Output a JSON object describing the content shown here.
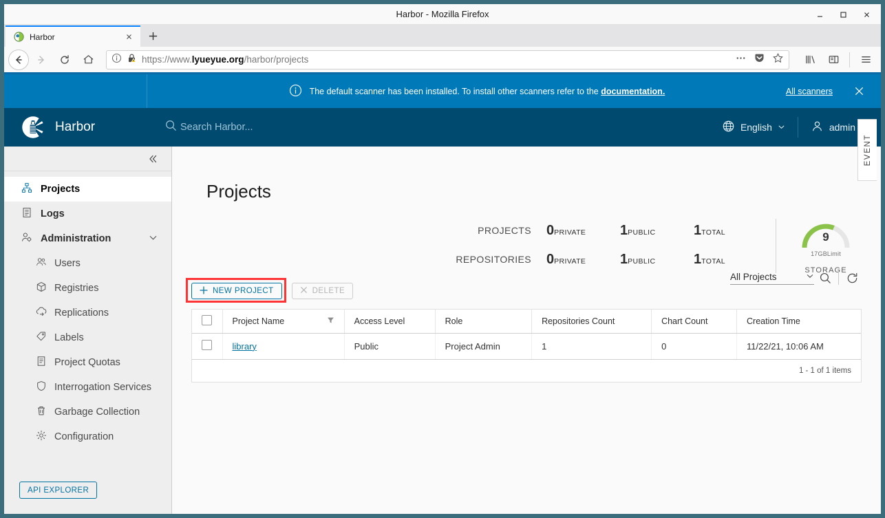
{
  "browser": {
    "window_title": "Harbor - Mozilla Firefox",
    "minimize_label": "Minimize",
    "maximize_label": "Maximize",
    "close_label": "Close",
    "tab": {
      "label": "Harbor",
      "close_label": "Close tab"
    },
    "new_tab_label": "+",
    "nav": {
      "back_label": "Back",
      "forward_label": "Forward",
      "reload_label": "Reload",
      "home_label": "Home"
    },
    "url": {
      "prefix": "https://www.",
      "domain": "lyueyue.org",
      "path": "/harbor/projects",
      "full": "https://www.lyueyue.org/harbor/projects"
    },
    "url_actions": {
      "page_actions": "…",
      "pocket": "Save to Pocket",
      "bookmark": "Bookmark"
    },
    "toolbar": {
      "library": "Library",
      "sidebars": "Sidebars",
      "menu": "Open menu"
    }
  },
  "banner": {
    "icon": "info-circle-icon",
    "message": "The default scanner has been installed. To install other scanners refer to the ",
    "link_text": "documentation.",
    "all_scanners": "All scanners",
    "close": "×",
    "bg_color": "#0079b8"
  },
  "header": {
    "brand": "Harbor",
    "search_placeholder": "Search Harbor...",
    "language": "English",
    "user": "admin",
    "bg_color": "#004a70"
  },
  "event_tab": {
    "label": "EVENT"
  },
  "sidebar": {
    "collapse_label": "«",
    "items": [
      {
        "label": "Projects",
        "icon": "projects-icon",
        "active": true,
        "level": 0
      },
      {
        "label": "Logs",
        "icon": "logs-icon",
        "active": false,
        "level": 0
      },
      {
        "label": "Administration",
        "icon": "administration-icon",
        "active": false,
        "level": 0,
        "expandable": true,
        "chevron": "⌄"
      },
      {
        "label": "Users",
        "icon": "users-icon",
        "active": false,
        "level": 1
      },
      {
        "label": "Registries",
        "icon": "registries-icon",
        "active": false,
        "level": 1
      },
      {
        "label": "Replications",
        "icon": "replications-icon",
        "active": false,
        "level": 1
      },
      {
        "label": "Labels",
        "icon": "labels-icon",
        "active": false,
        "level": 1
      },
      {
        "label": "Project Quotas",
        "icon": "project-quotas-icon",
        "active": false,
        "level": 1
      },
      {
        "label": "Interrogation Services",
        "icon": "interrogation-services-icon",
        "active": false,
        "level": 1
      },
      {
        "label": "Garbage Collection",
        "icon": "garbage-collection-icon",
        "active": false,
        "level": 1
      },
      {
        "label": "Configuration",
        "icon": "configuration-icon",
        "active": false,
        "level": 1
      }
    ],
    "api_explorer": "API EXPLORER"
  },
  "main": {
    "page_title": "Projects",
    "statistics": {
      "rows": [
        {
          "label": "PROJECTS",
          "cells": [
            {
              "num": "0",
              "unit": "PRIVATE"
            },
            {
              "num": "1",
              "unit": "PUBLIC"
            },
            {
              "num": "1",
              "unit": "TOTAL"
            }
          ]
        },
        {
          "label": "REPOSITORIES",
          "cells": [
            {
              "num": "0",
              "unit": "PRIVATE"
            },
            {
              "num": "1",
              "unit": "PUBLIC"
            },
            {
              "num": "1",
              "unit": "TOTAL"
            }
          ]
        }
      ],
      "storage": {
        "value": "9",
        "limit": "17GBLimit",
        "label": "STORAGE",
        "arc_percent": 52,
        "arc_color": "#8bc34a",
        "track_color": "#e6e6e6"
      }
    },
    "toolbar": {
      "new_project": "NEW PROJECT",
      "new_project_icon": "plus-icon",
      "delete": "DELETE",
      "delete_icon": "close-x-icon",
      "highlight_color": "#ff3333",
      "filter_select": "All Projects",
      "search_icon": "search-icon",
      "refresh_icon": "refresh-icon"
    },
    "table": {
      "columns": [
        "Project Name",
        "Access Level",
        "Role",
        "Repositories Count",
        "Chart Count",
        "Creation Time"
      ],
      "sort_filter_icon": "funnel-filter-icon",
      "rows": [
        {
          "project_name": "library",
          "access_level": "Public",
          "role": "Project Admin",
          "repositories_count": "1",
          "chart_count": "0",
          "creation_time": "11/22/21, 10:06 AM"
        }
      ],
      "footer": "1 - 1 of 1 items"
    }
  }
}
